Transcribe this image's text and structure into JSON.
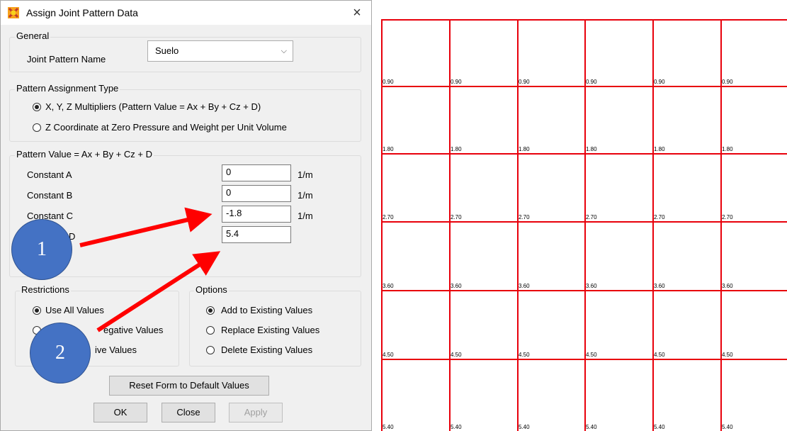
{
  "dialog": {
    "title": "Assign Joint Pattern Data",
    "close_symbol": "×",
    "general": {
      "label": "General",
      "joint_pattern_name_label": "Joint Pattern Name",
      "joint_pattern_name_value": "Suelo",
      "dropdown_chevron": "⌵"
    },
    "pattern_assignment_type": {
      "label": "Pattern Assignment Type",
      "option_xyz": "X, Y, Z Multipliers  (Pattern Value = Ax + By + Cz + D)",
      "option_zcoord": "Z Coordinate at Zero Pressure and Weight per Unit Volume",
      "selected": "xyz"
    },
    "pattern_value": {
      "label": "Pattern Value = Ax + By + Cz + D",
      "constant_a_label": "Constant A",
      "constant_a_value": "0",
      "constant_a_unit": "1/m",
      "constant_b_label": "Constant B",
      "constant_b_value": "0",
      "constant_b_unit": "1/m",
      "constant_c_label": "Constant C",
      "constant_c_value": "-1.8",
      "constant_c_unit": "1/m",
      "constant_d_label_visible": "D",
      "constant_d_value": "5.4"
    },
    "restrictions": {
      "label": "Restrictions",
      "option_all": "Use All Values",
      "option_negative_visible": "egative Values",
      "option_positive_visible": "ive Values"
    },
    "options": {
      "label": "Options",
      "option_add": "Add to Existing Values",
      "option_replace": "Replace Existing Values",
      "option_delete": "Delete Existing Values"
    },
    "buttons": {
      "reset": "Reset Form to Default Values",
      "ok": "OK",
      "close": "Close",
      "apply": "Apply"
    }
  },
  "annotations": {
    "bubble_1": "1",
    "bubble_2": "2",
    "arrow_color": "#ff0000",
    "bubble_color": "#4472c4"
  },
  "grid": {
    "line_color": "#e8000b",
    "row_values": [
      "0.90",
      "1.80",
      "2.70",
      "3.60",
      "4.50",
      "5.40"
    ],
    "columns": 6
  }
}
